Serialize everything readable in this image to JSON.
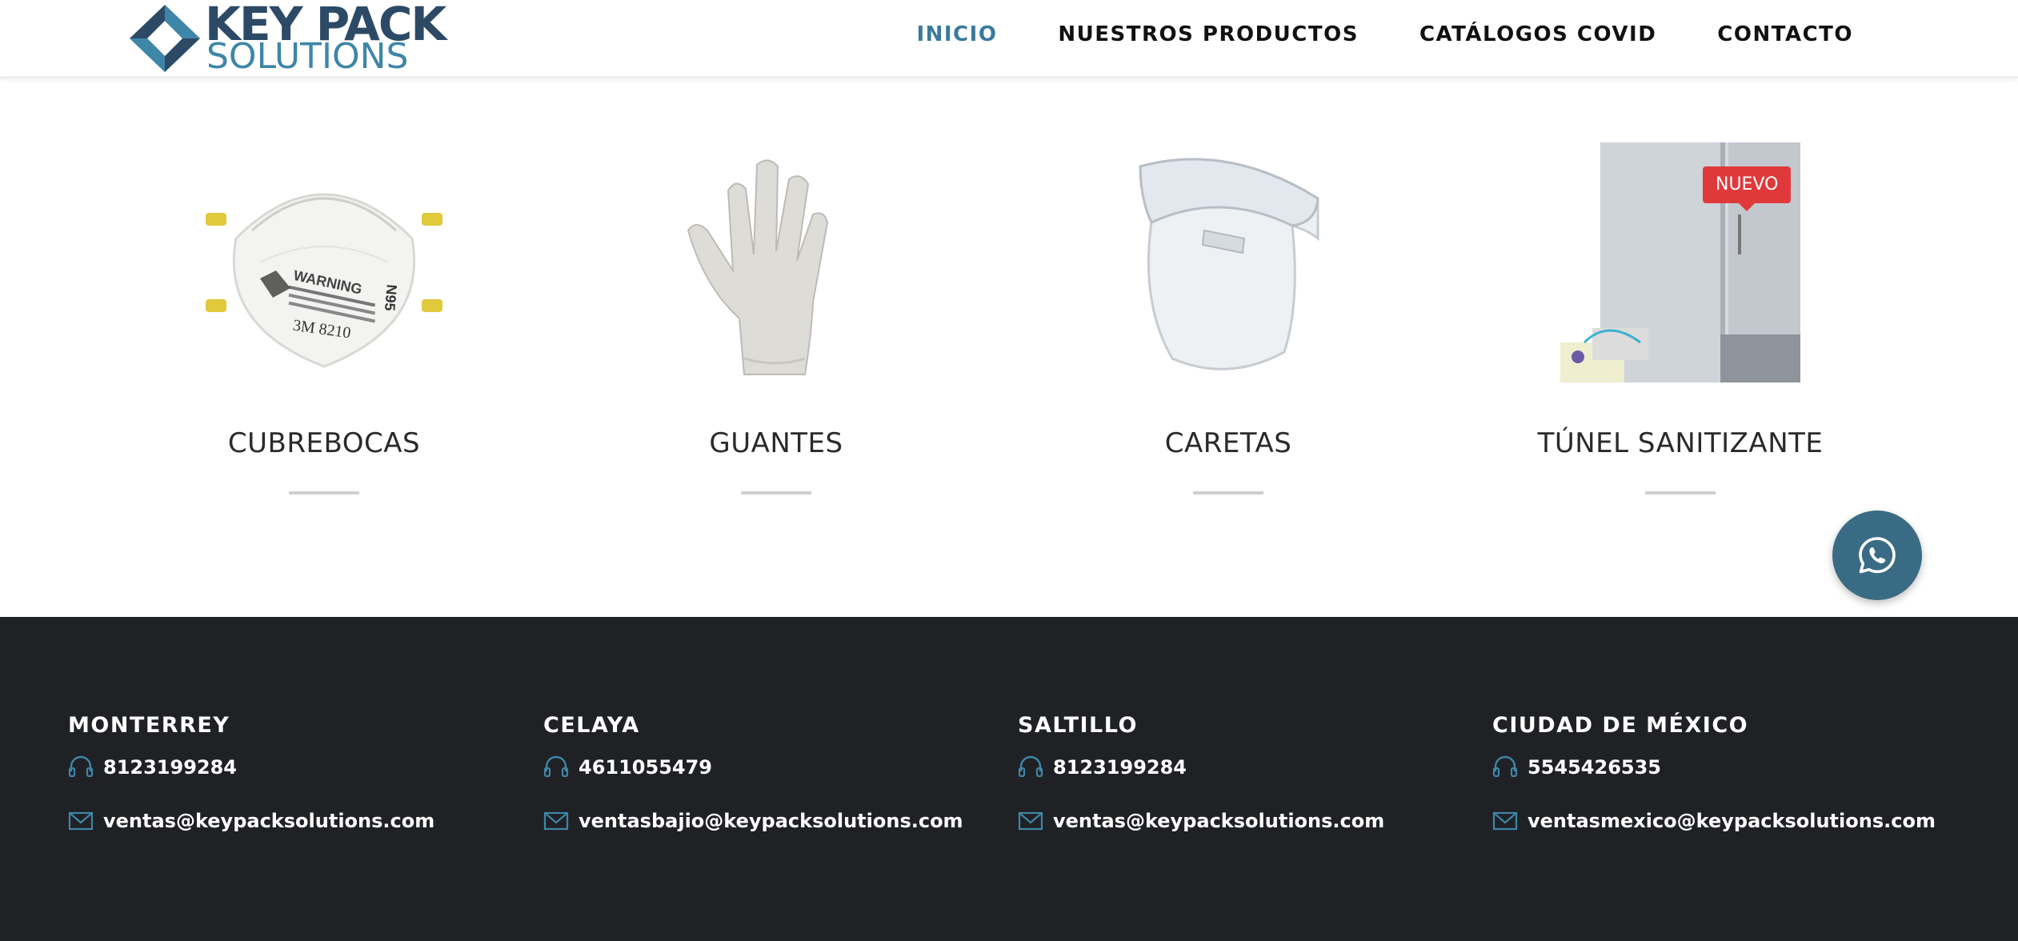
{
  "brand": {
    "line1": "KEY PACK",
    "line2": "SOLUTIONS",
    "colors": {
      "dark": "#2c4a66",
      "light": "#3e86a8"
    }
  },
  "nav": {
    "items": [
      {
        "label": "INICIO",
        "active": true
      },
      {
        "label": "NUESTROS PRODUCTOS",
        "active": false
      },
      {
        "label": "CATÁLOGOS COVID",
        "active": false
      },
      {
        "label": "CONTACTO",
        "active": false
      }
    ],
    "active_color": "#3a7a9c"
  },
  "products": [
    {
      "title": "CUBREBOCAS",
      "image": "n95-mask"
    },
    {
      "title": "GUANTES",
      "image": "latex-glove"
    },
    {
      "title": "CARETAS",
      "image": "face-shield"
    },
    {
      "title": "TÚNEL SANITIZANTE",
      "image": "sanitizing-tunnel",
      "badge": "NUEVO"
    }
  ],
  "product_mask_text": {
    "warning": "WARNING",
    "model": "3M 8210",
    "rating": "N95"
  },
  "whatsapp": {
    "icon": "whatsapp-icon",
    "color": "#3a6b84"
  },
  "footer": {
    "background": "#1f2124",
    "offices": [
      {
        "city": "MONTERREY",
        "phone": "8123199284",
        "email": "ventas@keypacksolutions.com"
      },
      {
        "city": "CELAYA",
        "phone": "4611055479",
        "email": "ventasbajio@keypacksolutions.com"
      },
      {
        "city": "SALTILLO",
        "phone": "8123199284",
        "email": "ventas@keypacksolutions.com"
      },
      {
        "city": "CIUDAD DE MÉXICO",
        "phone": "5545426535",
        "email": "ventasmexico@keypacksolutions.com"
      }
    ]
  }
}
